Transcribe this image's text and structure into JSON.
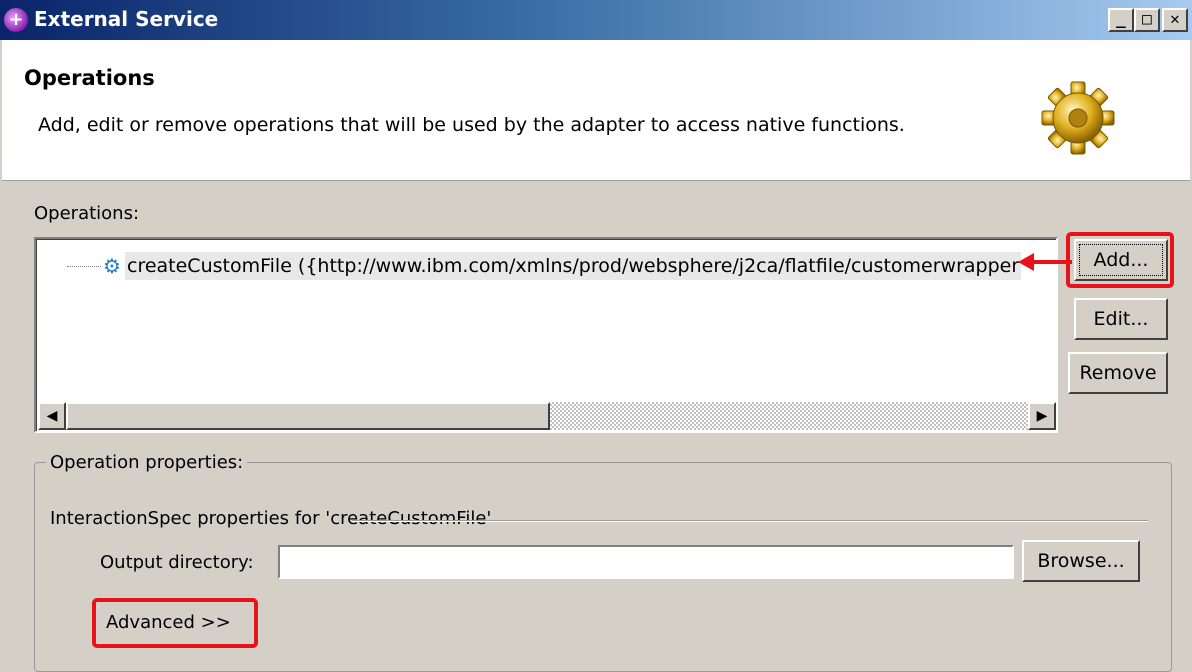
{
  "window": {
    "title": "External Service",
    "buttons": {
      "minimize": "_",
      "maximize": "□",
      "close": "✕"
    }
  },
  "header": {
    "title": "Operations",
    "description": "Add, edit or remove operations that will be used by the adapter to access native functions.",
    "image": "gear-icon"
  },
  "operations": {
    "label": "Operations:",
    "items": [
      {
        "icon": "operation-gear-icon",
        "text": "createCustomFile ({http://www.ibm.com/xmlns/prod/websphere/j2ca/flatfile/customerwrapper"
      }
    ],
    "buttons": {
      "add": "Add...",
      "edit": "Edit...",
      "remove": "Remove"
    },
    "scroll_left": "◀",
    "scroll_right": "▶"
  },
  "operation_properties": {
    "group_label": "Operation properties:",
    "subgroup_label": "InteractionSpec properties for 'createCustomFile'",
    "output_directory_label": "Output directory:",
    "output_directory_value": "",
    "browse_button": "Browse...",
    "advanced_button": "Advanced >>"
  },
  "annotation_color": "#e8121a"
}
